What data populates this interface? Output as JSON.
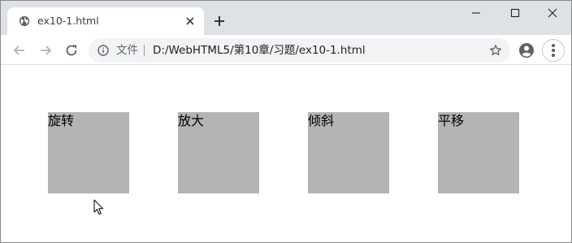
{
  "tab": {
    "title": "ex10-1.html",
    "favicon": "globe-icon"
  },
  "window_controls": [
    "minimize-icon",
    "maximize-icon",
    "close-icon"
  ],
  "omnibox": {
    "scheme_label": "文件",
    "url": "D:/WebHTML5/第10章/习题/ex10-1.html"
  },
  "page": {
    "boxes": [
      {
        "label": "旋转"
      },
      {
        "label": "放大"
      },
      {
        "label": "倾斜"
      },
      {
        "label": "平移"
      }
    ],
    "box_color": "#b4b4b4"
  },
  "colors": {
    "tabstrip": "#dee1e6",
    "omnibox": "#f1f3f4"
  }
}
